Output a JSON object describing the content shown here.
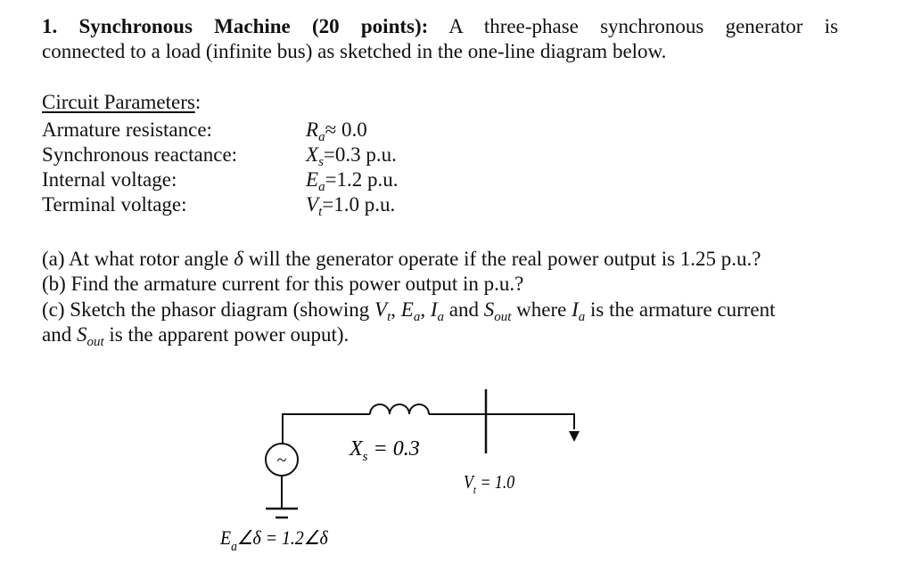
{
  "problem": {
    "number": "1.",
    "title": "Synchronous Machine (20 points):",
    "intro_line1": "A three-phase synchronous generator is",
    "intro_line2": "connected to a load (infinite bus) as sketched in the one-line diagram below."
  },
  "parameters": {
    "heading": "Circuit Parameters",
    "heading_colon": ":",
    "rows": [
      {
        "label": "Armature resistance:",
        "sym": "R",
        "sub": "a",
        "rel": "≈",
        "value": " 0.0"
      },
      {
        "label": "Synchronous reactance:",
        "sym": "X",
        "sub": "s",
        "rel": "=",
        "value": "0.3 p.u."
      },
      {
        "label": "Internal voltage:",
        "sym": "E",
        "sub": "a",
        "rel": "=",
        "value": "1.2 p.u."
      },
      {
        "label": "Terminal voltage:",
        "sym": "V",
        "sub": "t",
        "rel": "=",
        "value": "1.0 p.u."
      }
    ]
  },
  "questions": {
    "a_pre": "(a) At what rotor angle ",
    "a_sym": "δ",
    "a_post": " will the generator operate if the real power output is 1.25 p.u.?",
    "b": "(b) Find the armature current for this power output in p.u.?",
    "c_pre": "(c) Sketch the phasor diagram (showing ",
    "c_vt": "V",
    "c_vt_sub": "t",
    "c_sep1": ", ",
    "c_ea": "E",
    "c_ea_sub": "a",
    "c_sep2": ", ",
    "c_ia": "I",
    "c_ia_sub": "a",
    "c_and": " and ",
    "c_s": "S",
    "c_s_sub": "out",
    "c_where": " where ",
    "c_ia2": "I",
    "c_ia2_sub": "a",
    "c_post": " is the armature current",
    "c2_pre": "and ",
    "c2_s": "S",
    "c2_s_sub": "out",
    "c2_post": " is the apparent power ouput)."
  },
  "diagram": {
    "generator_symbol": "~",
    "xs_label": "X",
    "xs_sub": "s",
    "xs_value": " = 0.3",
    "vt_label": "V",
    "vt_sub": "t",
    "vt_value": " = 1.0",
    "ea_label": "E",
    "ea_sub": "a",
    "ea_value": "∠δ = 1.2∠δ"
  }
}
